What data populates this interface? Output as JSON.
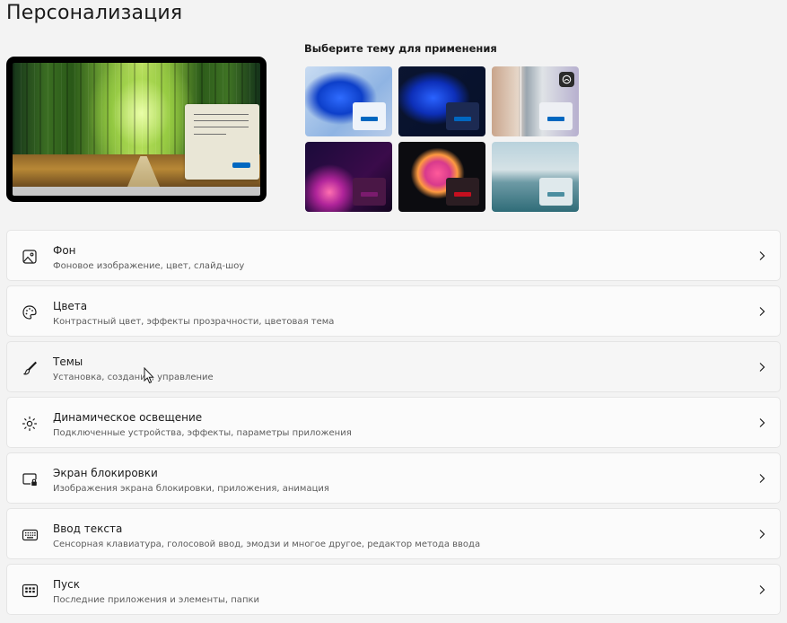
{
  "page": {
    "title": "Персонализация"
  },
  "themes": {
    "label": "Выберите тему для применения",
    "items": [
      {
        "id": "light",
        "accent": "#0067c0"
      },
      {
        "id": "dark",
        "accent": "#0067c0"
      },
      {
        "id": "glow",
        "accent": "#0067c0"
      },
      {
        "id": "bloom",
        "accent": "#7b1b6e"
      },
      {
        "id": "captured",
        "accent": "#c50f1f"
      },
      {
        "id": "flow",
        "accent": "#4a8ea0"
      }
    ]
  },
  "settings": [
    {
      "icon": "image-icon",
      "title": "Фон",
      "description": "Фоновое изображение, цвет, слайд-шоу"
    },
    {
      "icon": "palette-icon",
      "title": "Цвета",
      "description": "Контрастный цвет, эффекты прозрачности, цветовая тема"
    },
    {
      "icon": "brush-icon",
      "title": "Темы",
      "description": "Установка, создание, управление"
    },
    {
      "icon": "dynamic-lighting-icon",
      "title": "Динамическое освещение",
      "description": "Подключенные устройства, эффекты, параметры приложения"
    },
    {
      "icon": "lock-screen-icon",
      "title": "Экран блокировки",
      "description": "Изображения экрана блокировки, приложения, анимация"
    },
    {
      "icon": "keyboard-icon",
      "title": "Ввод текста",
      "description": "Сенсорная клавиатура, голосовой ввод, эмодзи и многое другое, редактор метода ввода"
    },
    {
      "icon": "start-icon",
      "title": "Пуск",
      "description": "Последние приложения и элементы, папки"
    }
  ],
  "colors": {
    "accent": "#0067c0",
    "background": "#f3f3f3",
    "card": "#fbfbfb"
  }
}
